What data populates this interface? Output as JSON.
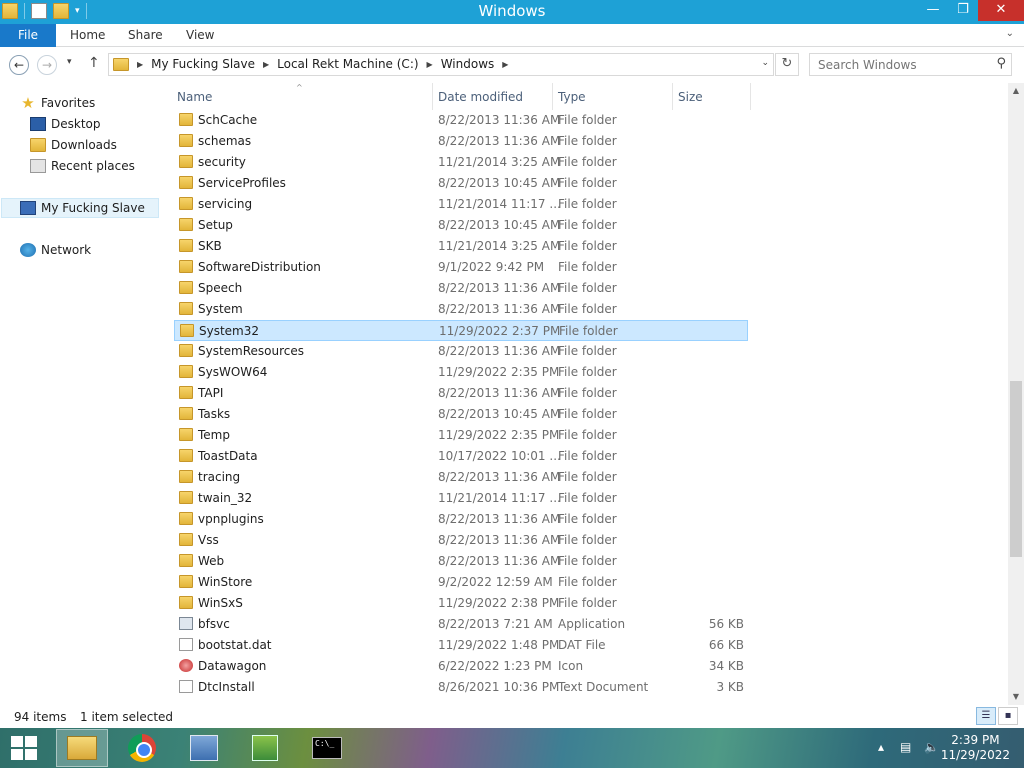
{
  "window": {
    "title": "Windows"
  },
  "ribbon": {
    "file": "File",
    "tabs": [
      "Home",
      "Share",
      "View"
    ]
  },
  "address": {
    "crumbs": [
      "My Fucking Slave",
      "Local Rekt Machine (C:)",
      "Windows"
    ]
  },
  "search": {
    "placeholder": "Search Windows"
  },
  "nav": {
    "favorites": "Favorites",
    "desktop": "Desktop",
    "downloads": "Downloads",
    "recent": "Recent places",
    "pc": "My Fucking Slave",
    "network": "Network"
  },
  "columns": {
    "name": "Name",
    "date": "Date modified",
    "type": "Type",
    "size": "Size"
  },
  "files": [
    {
      "name": "SchCache",
      "date": "8/22/2013 11:36 AM",
      "type": "File folder",
      "size": "",
      "icon": "folder-icon"
    },
    {
      "name": "schemas",
      "date": "8/22/2013 11:36 AM",
      "type": "File folder",
      "size": "",
      "icon": "folder-icon"
    },
    {
      "name": "security",
      "date": "11/21/2014 3:25 AM",
      "type": "File folder",
      "size": "",
      "icon": "folder-icon"
    },
    {
      "name": "ServiceProfiles",
      "date": "8/22/2013 10:45 AM",
      "type": "File folder",
      "size": "",
      "icon": "folder-icon"
    },
    {
      "name": "servicing",
      "date": "11/21/2014 11:17 ...",
      "type": "File folder",
      "size": "",
      "icon": "folder-icon"
    },
    {
      "name": "Setup",
      "date": "8/22/2013 10:45 AM",
      "type": "File folder",
      "size": "",
      "icon": "folder-icon"
    },
    {
      "name": "SKB",
      "date": "11/21/2014 3:25 AM",
      "type": "File folder",
      "size": "",
      "icon": "folder-icon"
    },
    {
      "name": "SoftwareDistribution",
      "date": "9/1/2022 9:42 PM",
      "type": "File folder",
      "size": "",
      "icon": "folder-icon"
    },
    {
      "name": "Speech",
      "date": "8/22/2013 11:36 AM",
      "type": "File folder",
      "size": "",
      "icon": "folder-icon"
    },
    {
      "name": "System",
      "date": "8/22/2013 11:36 AM",
      "type": "File folder",
      "size": "",
      "icon": "folder-icon"
    },
    {
      "name": "System32",
      "date": "11/29/2022 2:37 PM",
      "type": "File folder",
      "size": "",
      "icon": "folder-icon",
      "selected": true
    },
    {
      "name": "SystemResources",
      "date": "8/22/2013 11:36 AM",
      "type": "File folder",
      "size": "",
      "icon": "folder-icon"
    },
    {
      "name": "SysWOW64",
      "date": "11/29/2022 2:35 PM",
      "type": "File folder",
      "size": "",
      "icon": "folder-icon"
    },
    {
      "name": "TAPI",
      "date": "8/22/2013 11:36 AM",
      "type": "File folder",
      "size": "",
      "icon": "folder-icon"
    },
    {
      "name": "Tasks",
      "date": "8/22/2013 10:45 AM",
      "type": "File folder",
      "size": "",
      "icon": "folder-icon"
    },
    {
      "name": "Temp",
      "date": "11/29/2022 2:35 PM",
      "type": "File folder",
      "size": "",
      "icon": "folder-icon"
    },
    {
      "name": "ToastData",
      "date": "10/17/2022 10:01 ...",
      "type": "File folder",
      "size": "",
      "icon": "folder-icon"
    },
    {
      "name": "tracing",
      "date": "8/22/2013 11:36 AM",
      "type": "File folder",
      "size": "",
      "icon": "folder-icon"
    },
    {
      "name": "twain_32",
      "date": "11/21/2014 11:17 ...",
      "type": "File folder",
      "size": "",
      "icon": "folder-icon"
    },
    {
      "name": "vpnplugins",
      "date": "8/22/2013 11:36 AM",
      "type": "File folder",
      "size": "",
      "icon": "folder-icon"
    },
    {
      "name": "Vss",
      "date": "8/22/2013 11:36 AM",
      "type": "File folder",
      "size": "",
      "icon": "folder-icon"
    },
    {
      "name": "Web",
      "date": "8/22/2013 11:36 AM",
      "type": "File folder",
      "size": "",
      "icon": "folder-icon"
    },
    {
      "name": "WinStore",
      "date": "9/2/2022 12:59 AM",
      "type": "File folder",
      "size": "",
      "icon": "folder-icon"
    },
    {
      "name": "WinSxS",
      "date": "11/29/2022 2:38 PM",
      "type": "File folder",
      "size": "",
      "icon": "folder-icon"
    },
    {
      "name": "bfsvc",
      "date": "8/22/2013 7:21 AM",
      "type": "Application",
      "size": "56 KB",
      "icon": "application-icon"
    },
    {
      "name": "bootstat.dat",
      "date": "11/29/2022 1:48 PM",
      "type": "DAT File",
      "size": "66 KB",
      "icon": "dat-file-icon"
    },
    {
      "name": "Datawagon",
      "date": "6/22/2022 1:23 PM",
      "type": "Icon",
      "size": "34 KB",
      "icon": "icon-file-icon"
    },
    {
      "name": "DtcInstall",
      "date": "8/26/2021 10:36 PM",
      "type": "Text Document",
      "size": "3 KB",
      "icon": "text-document-icon"
    }
  ],
  "status": {
    "items": "94 items",
    "selected": "1 item selected"
  },
  "tray": {
    "time": "2:39 PM",
    "date": "11/29/2022"
  }
}
